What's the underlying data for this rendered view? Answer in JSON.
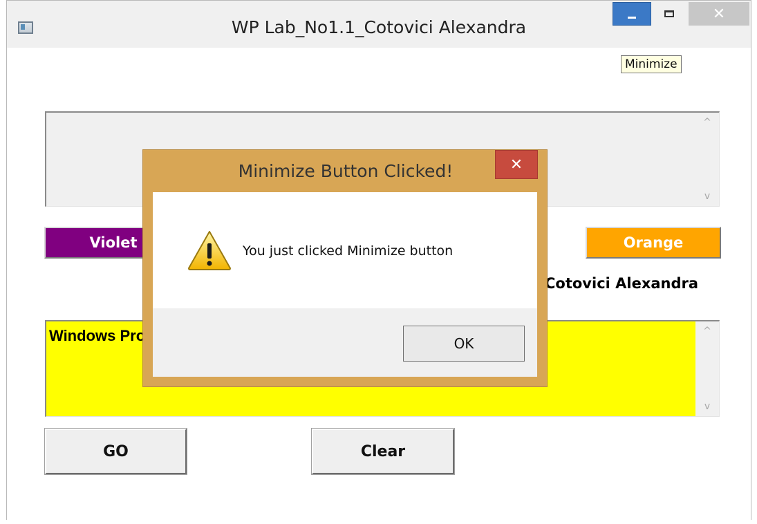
{
  "window": {
    "title": "WP Lab_No1.1_Cotovici Alexandra",
    "close_glyph": "✕",
    "tooltip": "Minimize"
  },
  "main": {
    "top_edit_text": "",
    "violet_label": "Violet",
    "orange_label": "Orange",
    "name_label": "Cotovici Alexandra",
    "yellow_edit_text": "Windows Programming",
    "go_label": "GO",
    "clear_label": "Clear"
  },
  "dialog": {
    "title": "Minimize Button Clicked!",
    "close_glyph": "✕",
    "message": "You just clicked Minimize button",
    "ok_label": "OK",
    "icon": "warning-icon"
  },
  "colors": {
    "violet": "#800080",
    "orange": "#ffa500",
    "yellow": "#ffff00",
    "dialog_frame": "#d8a655",
    "dialog_close": "#c74b3e",
    "minimize_active": "#3b79c6"
  }
}
